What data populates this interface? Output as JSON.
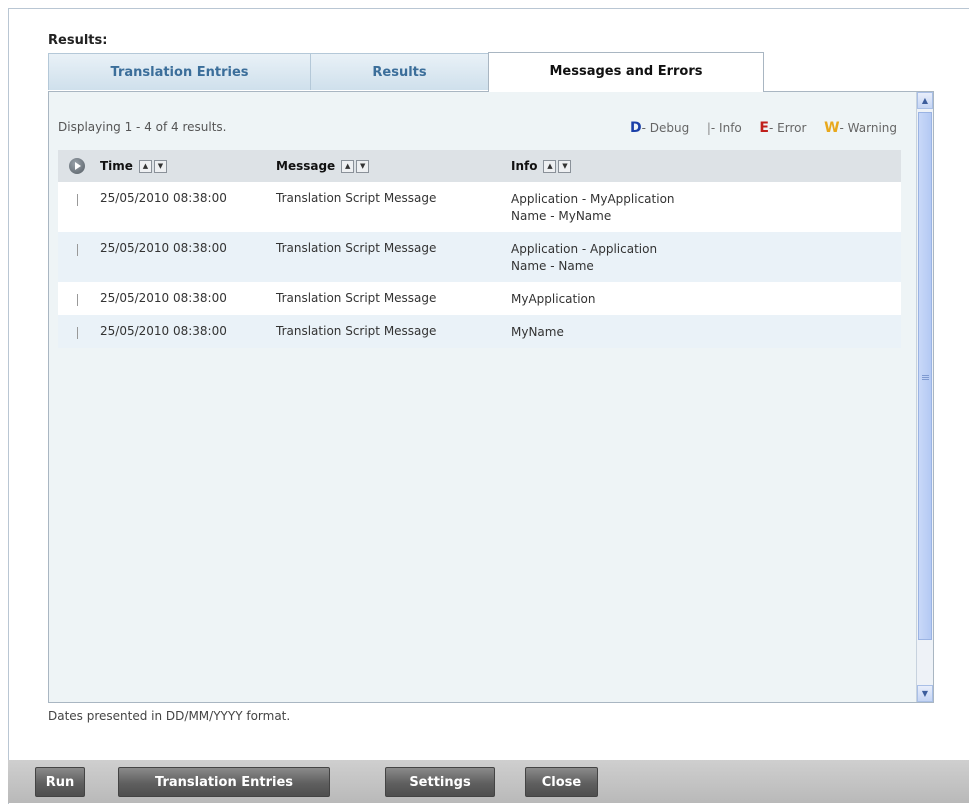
{
  "results_title": "Results:",
  "tabs": [
    {
      "label": "Translation Entries",
      "active": false
    },
    {
      "label": "Results",
      "active": false
    },
    {
      "label": "Messages and Errors",
      "active": true
    }
  ],
  "display_count": "Displaying 1 - 4 of 4 results.",
  "legend": {
    "debug_key": "D",
    "debug_label": "- Debug",
    "info_key": "|",
    "info_label": "- Info",
    "error_key": "E",
    "error_label": "- Error",
    "warning_key": "W",
    "warning_label": "- Warning",
    "colors": {
      "debug": "#1a3fa8",
      "info": "#888888",
      "error": "#c0201c",
      "warning": "#e8a81c"
    }
  },
  "columns": {
    "time": "Time",
    "message": "Message",
    "info": "Info"
  },
  "rows": [
    {
      "time": "25/05/2010 08:38:00",
      "message": "Translation Script Message",
      "info": [
        "Application - MyApplication",
        "Name - MyName"
      ]
    },
    {
      "time": "25/05/2010 08:38:00",
      "message": "Translation Script Message",
      "info": [
        "Application - Application",
        "Name - Name"
      ]
    },
    {
      "time": "25/05/2010 08:38:00",
      "message": "Translation Script Message",
      "info": [
        "MyApplication"
      ]
    },
    {
      "time": "25/05/2010 08:38:00",
      "message": "Translation Script Message",
      "info": [
        "MyName"
      ]
    }
  ],
  "date_note": "Dates presented in DD/MM/YYYY format.",
  "footer_buttons": {
    "run": "Run",
    "translation_entries": "Translation Entries",
    "settings": "Settings",
    "close": "Close"
  }
}
